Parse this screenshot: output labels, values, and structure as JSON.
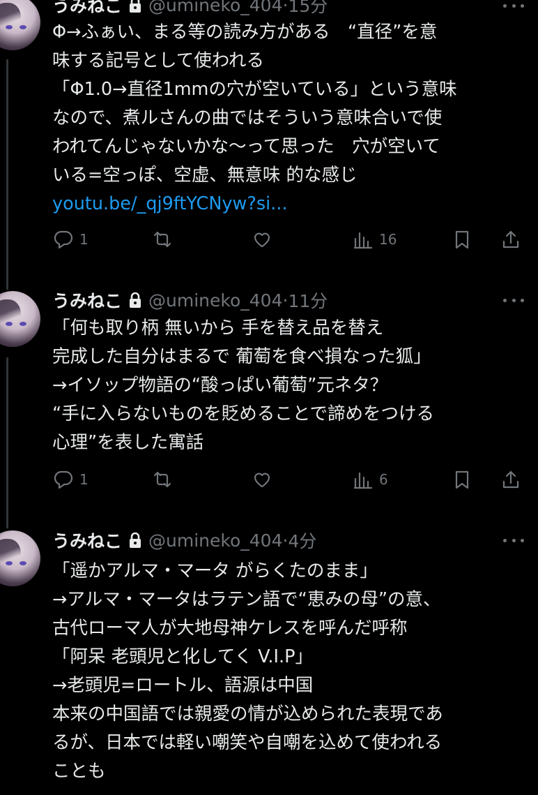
{
  "tweets": [
    {
      "name": "うみねこ",
      "handle": "@umineko_404",
      "separator": "·",
      "time": "15分",
      "lines": [
        "Φ→ふぁい、まる等の読み方がある　“直径”を意",
        "味する記号として使われる",
        "「Φ1.0→直径1mmの穴が空いている」という意味",
        "なので、煮ルさんの曲ではそういう意味合いで使",
        "われてんじゃないかな〜って思った　穴が空いて",
        "いる=空っぽ、空虚、無意味 的な感じ"
      ],
      "link": "youtu.be/_qj9ftYCNyw?si...",
      "replies": "1",
      "retweets": "",
      "likes": "",
      "views": "16"
    },
    {
      "name": "うみねこ",
      "handle": "@umineko_404",
      "separator": "·",
      "time": "11分",
      "lines": [
        "「何も取り柄 無いから 手を替え品を替え",
        "完成した自分はまるで 葡萄を食べ損なった狐」",
        "→イソップ物語の“酸っぱい葡萄”元ネタ？",
        "“手に入らないものを貶めることで諦めをつける",
        "心理”を表した寓話"
      ],
      "replies": "1",
      "retweets": "",
      "likes": "",
      "views": "6"
    },
    {
      "name": "うみねこ",
      "handle": "@umineko_404",
      "separator": "·",
      "time": "4分",
      "lines": [
        "「遥かアルマ・マータ がらくたのまま」",
        "→アルマ・マータはラテン語で“恵みの母”の意、",
        "古代ローマ人が大地母神ケレスを呼んだ呼称",
        "「阿呆 老頭児と化してく V.I.P」",
        "→老頭児=ロートル、語源は中国",
        "本来の中国語では親愛の情が込められた表現であ",
        "るが、日本では軽い嘲笑や自嘲を込めて使われる",
        "ことも"
      ]
    }
  ],
  "icons": {
    "reply": "reply-icon",
    "retweet": "retweet-icon",
    "like": "heart-icon",
    "views": "views-icon",
    "bookmark": "bookmark-icon",
    "share": "share-icon",
    "more": "more-icon",
    "lock": "lock-icon"
  },
  "colors": {
    "background": "#000000",
    "text": "#e7e9ea",
    "secondary": "#71767b",
    "link": "#1d9bf0"
  }
}
